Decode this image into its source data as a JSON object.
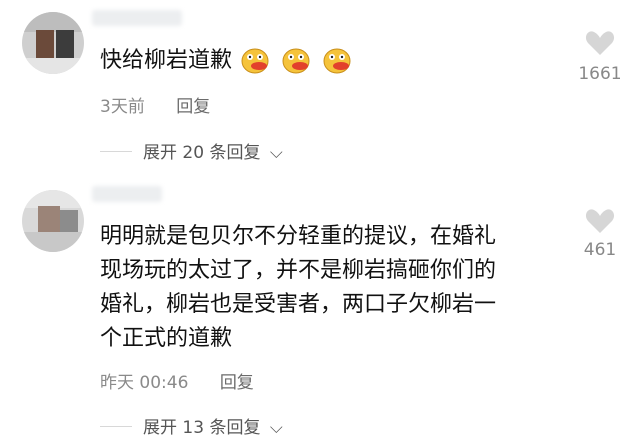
{
  "comments": [
    {
      "text": "快给柳岩道歉",
      "emojis": [
        "grimace-emoji",
        "grimace-emoji",
        "grimace-emoji"
      ],
      "time": "3天前",
      "reply_label": "回复",
      "likes": "1661",
      "expand_label": "展开 20 条回复"
    },
    {
      "lines": [
        "明明就是包贝尔不分轻重的提议，在婚礼",
        "现场玩的太过了，并不是柳岩搞砸你们的",
        "婚礼，柳岩也是受害者，两口子欠柳岩一",
        "个正式的道歉"
      ],
      "time": "昨天 00:46",
      "reply_label": "回复",
      "likes": "461",
      "expand_label": "展开 13 条回复"
    }
  ],
  "colors": {
    "text": "#111111",
    "meta": "#8a8a8a",
    "heart": "#d6d6d6",
    "emoji_face": "#f5c33b"
  }
}
